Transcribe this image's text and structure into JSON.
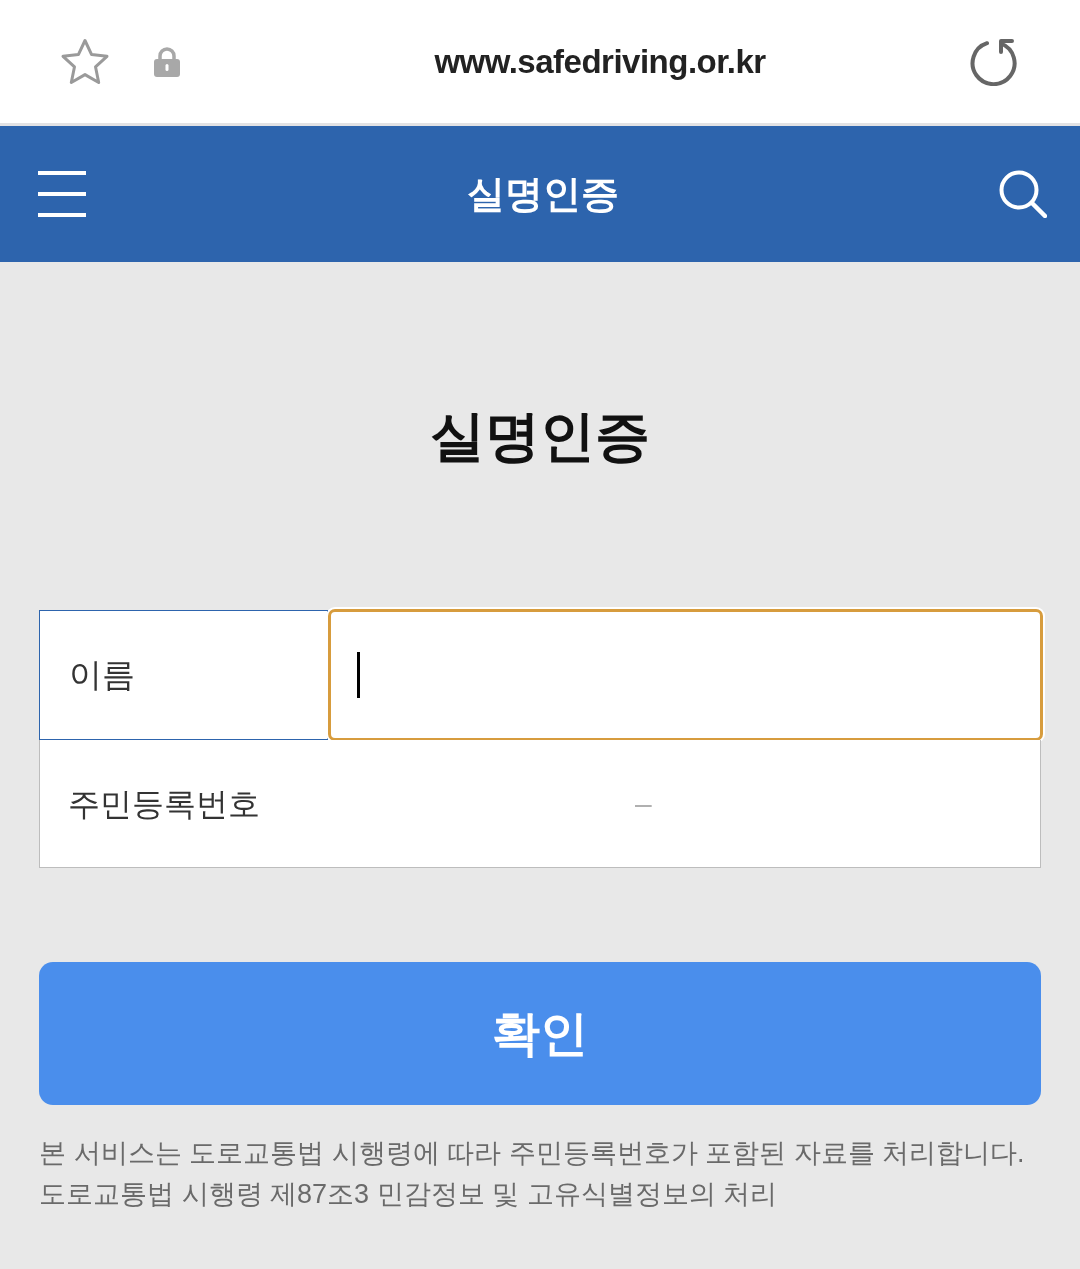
{
  "browser_bar": {
    "url": "www.safedriving.or.kr"
  },
  "header": {
    "title": "실명인증"
  },
  "page_title": "실명인증",
  "form": {
    "rows": [
      {
        "kind": "text",
        "label": "이름",
        "focused": true
      },
      {
        "kind": "rrn",
        "label": "주민등록번호",
        "separator": "–",
        "focused": false
      }
    ]
  },
  "confirm_button": {
    "label": "확인"
  },
  "notice": [
    "본 서비스는 도로교통법 시행령에 따라 주민등록번호가 포함된 자료를 처리합니다.",
    "도로교통법 시행령 제87조3 민감정보 및 고유식별정보의 처리"
  ]
}
